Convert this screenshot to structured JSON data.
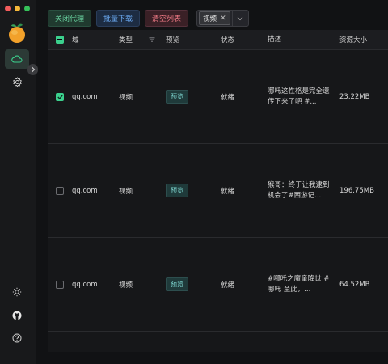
{
  "toolbar": {
    "close_proxy": "关闭代理",
    "batch_download": "批量下载",
    "clear_list": "清空列表",
    "filter_chip": "视频"
  },
  "table": {
    "headers": {
      "domain": "域",
      "type": "类型",
      "preview": "预览",
      "status": "状态",
      "description": "描述",
      "size": "资源大小"
    },
    "rows": [
      {
        "checked": true,
        "domain": "qq.com",
        "type": "视频",
        "preview": "预览",
        "status": "就绪",
        "desc_line1": "哪吒这性格是完全遗",
        "desc_line2": "传下来了吧 #...",
        "size": "23.22MB"
      },
      {
        "checked": false,
        "domain": "qq.com",
        "type": "视频",
        "preview": "预览",
        "status": "就绪",
        "desc_line1": "猴哥：终于让我逮到",
        "desc_line2": "机会了#西游记...",
        "size": "196.75MB"
      },
      {
        "checked": false,
        "domain": "qq.com",
        "type": "视频",
        "preview": "预览",
        "status": "就绪",
        "desc_line1": "#哪吒之魔童降世 #",
        "desc_line2": "哪吒 至此，...",
        "size": "64.52MB"
      }
    ]
  },
  "icons": {
    "cloud": "cloud-icon",
    "settings": "gear-icon",
    "theme": "sun-icon",
    "github": "github-icon",
    "help": "help-icon",
    "filter": "filter-icon"
  },
  "colors": {
    "accent_green": "#3bd08d",
    "danger": "#f07a85",
    "info": "#6aa8f0"
  }
}
